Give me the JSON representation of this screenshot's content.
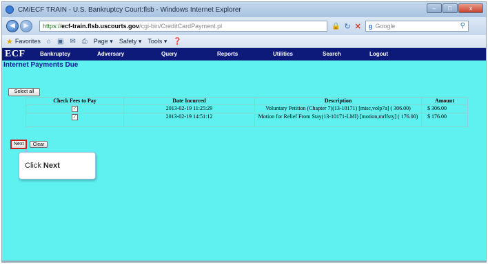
{
  "window": {
    "title": "CM/ECF TRAIN - U.S. Bankruptcy Court:flsb - Windows Internet Explorer",
    "buttons": {
      "minimize": "–",
      "maximize": "□",
      "close": "x"
    }
  },
  "address": {
    "url_proto": "https://",
    "url_domain": "ecf-train.flsb.uscourts.gov",
    "url_path": "/cgi-bin/CreditCardPayment.pl",
    "search_placeholder": "Google"
  },
  "command_bar": {
    "favorites": "Favorites",
    "page": "Page ▾",
    "safety": "Safety ▾",
    "tools": "Tools ▾"
  },
  "ecf": {
    "logo": "ECF",
    "menu": [
      "Bankruptcy",
      "Adversary",
      "Query",
      "Reports",
      "Utilities",
      "Search",
      "Logout"
    ]
  },
  "page": {
    "heading": "Internet Payments Due",
    "select_all": "Select all",
    "columns": [
      "Check Fees to Pay",
      "Date Incurred",
      "Description",
      "Amount"
    ],
    "rows": [
      {
        "checked": "✓",
        "date": "2013-02-19 11:25:29",
        "description": "Voluntary Petition (Chapter 7)(13-10171) [misc,volp7a] ( 306.00)",
        "amount": "$ 306.00"
      },
      {
        "checked": "✓",
        "date": "2013-02-19 14:51:12",
        "description": "Motion for Relief From Stay(13-10171-LMI) [motion,mrlfsty] ( 176.00)",
        "amount": "$ 176.00"
      }
    ],
    "next_label": "Next",
    "clear_label": "Clear"
  },
  "callout": {
    "prefix": "Click ",
    "bold": "Next"
  },
  "colors": {
    "page_background": "#5ff0f0",
    "nav_background": "#0d1a7a",
    "highlight_border": "#cc2020"
  }
}
